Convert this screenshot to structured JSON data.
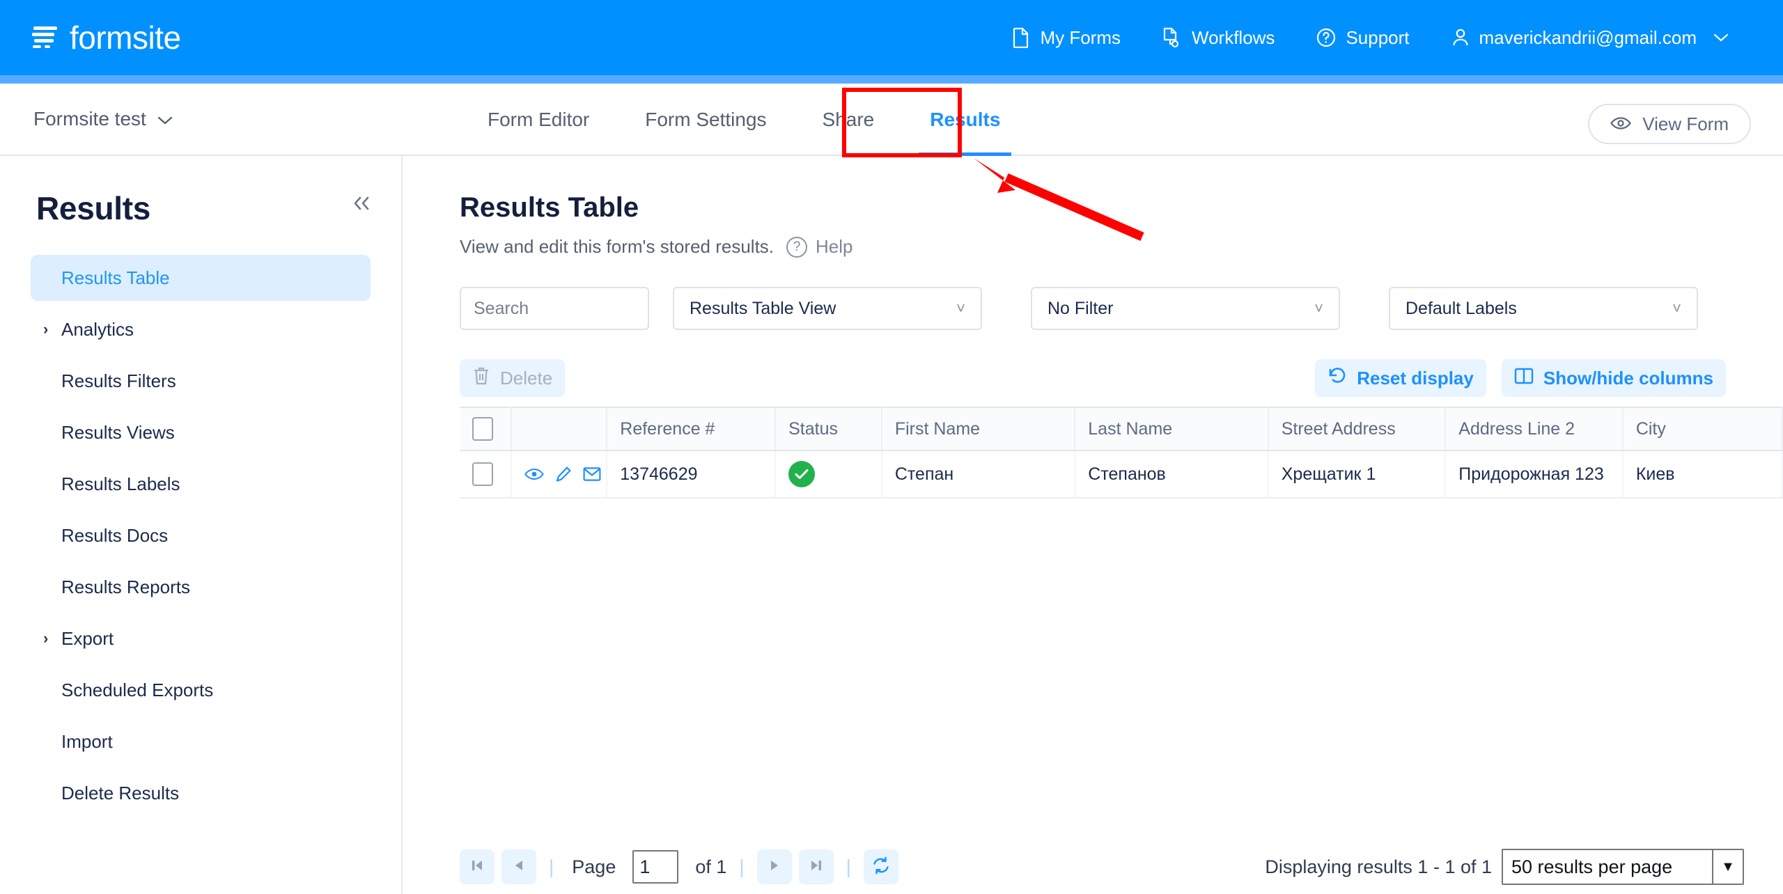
{
  "topbar": {
    "brand": "formsite",
    "brand_icon": "formsite-logo-icon",
    "nav": [
      {
        "label": "My Forms",
        "icon": "document-icon"
      },
      {
        "label": "Workflows",
        "icon": "workflow-icon"
      },
      {
        "label": "Support",
        "icon": "question-circle-icon"
      },
      {
        "label": "maverickandrii@gmail.com",
        "icon": "user-icon"
      }
    ]
  },
  "formnav": {
    "form_title": "Formsite test",
    "tabs": [
      {
        "label": "Form Editor",
        "active": false
      },
      {
        "label": "Form Settings",
        "active": false
      },
      {
        "label": "Share",
        "active": false
      },
      {
        "label": "Results",
        "active": true
      }
    ],
    "view_form_label": "View Form",
    "view_form_icon": "eye-icon"
  },
  "sidebar": {
    "title": "Results",
    "collapse_icon": "double-chevron-left-icon",
    "items": [
      {
        "label": "Results Table",
        "active": true,
        "expandable": false
      },
      {
        "label": "Analytics",
        "active": false,
        "expandable": true
      },
      {
        "label": "Results Filters",
        "active": false,
        "expandable": false
      },
      {
        "label": "Results Views",
        "active": false,
        "expandable": false
      },
      {
        "label": "Results Labels",
        "active": false,
        "expandable": false
      },
      {
        "label": "Results Docs",
        "active": false,
        "expandable": false
      },
      {
        "label": "Results Reports",
        "active": false,
        "expandable": false
      },
      {
        "label": "Export",
        "active": false,
        "expandable": true
      },
      {
        "label": "Scheduled Exports",
        "active": false,
        "expandable": false
      },
      {
        "label": "Import",
        "active": false,
        "expandable": false
      },
      {
        "label": "Delete Results",
        "active": false,
        "expandable": false
      }
    ]
  },
  "main": {
    "title": "Results Table",
    "subtitle": "View and edit this form's stored results.",
    "help_label": "Help",
    "search": {
      "value": "",
      "placeholder": "Search",
      "icon": "search-icon"
    },
    "dropdowns": {
      "view": "Results Table View",
      "filter": "No Filter",
      "labels": "Default Labels"
    },
    "toolbar": {
      "delete_label": "Delete",
      "delete_icon": "trash-icon",
      "delete_disabled": true,
      "reset_label": "Reset display",
      "reset_icon": "reset-arrow-icon",
      "columns_label": "Show/hide columns",
      "columns_icon": "columns-icon"
    },
    "table": {
      "columns": [
        "",
        "",
        "Reference #",
        "Status",
        "First Name",
        "Last Name",
        "Street Address",
        "Address Line 2",
        "City"
      ],
      "rows": [
        {
          "reference": "13746629",
          "status": "complete",
          "first_name": "Степан",
          "last_name": "Степанов",
          "street_address": "Хрещатик 1",
          "address_line_2": "Придорожная 123",
          "city": "Киев"
        }
      ]
    },
    "footer": {
      "page_label": "Page",
      "page_value": "1",
      "of_label": "of 1",
      "first_icon": "first-page-icon",
      "prev_icon": "prev-page-icon",
      "next_icon": "next-page-icon",
      "last_icon": "last-page-icon",
      "refresh_icon": "refresh-icon",
      "displaying": "Displaying results 1 - 1 of 1",
      "per_page": "50 results per page"
    }
  },
  "annotation": {
    "highlight_target": "Results",
    "arrow_color": "#FF0000"
  },
  "colors": {
    "brand_blue": "#0090FF",
    "accent_blue": "#1E90FF",
    "status_green": "#22b14c",
    "annotation_red": "#FF0000"
  }
}
